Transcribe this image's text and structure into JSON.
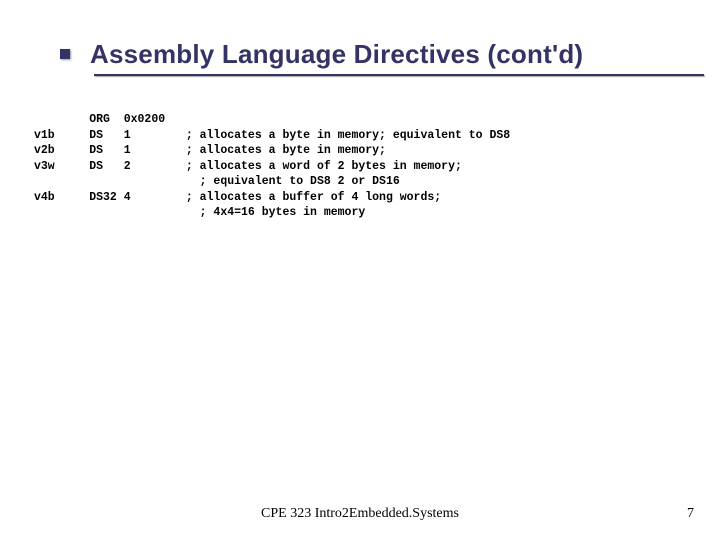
{
  "title": "Assembly Language Directives (cont'd)",
  "code": {
    "rows": [
      {
        "label": "",
        "directive": "ORG  0x0200",
        "comment": ""
      },
      {
        "label": "v1b",
        "directive": "DS   1",
        "comment": "; allocates a byte in memory; equivalent to DS8"
      },
      {
        "label": "v2b",
        "directive": "DS   1",
        "comment": "; allocates a byte in memory;"
      },
      {
        "label": "v3w",
        "directive": "DS   2",
        "comment": "; allocates a word of 2 bytes in memory;"
      },
      {
        "label": "",
        "directive": "",
        "comment": "  ; equivalent to DS8 2 or DS16"
      },
      {
        "label": "v4b",
        "directive": "DS32 4",
        "comment": "; allocates a buffer of 4 long words;"
      },
      {
        "label": "",
        "directive": "",
        "comment": "  ; 4x4=16 bytes in memory"
      }
    ]
  },
  "footer_text": "CPE 323 Intro2Embedded.Systems",
  "page_number": "7"
}
